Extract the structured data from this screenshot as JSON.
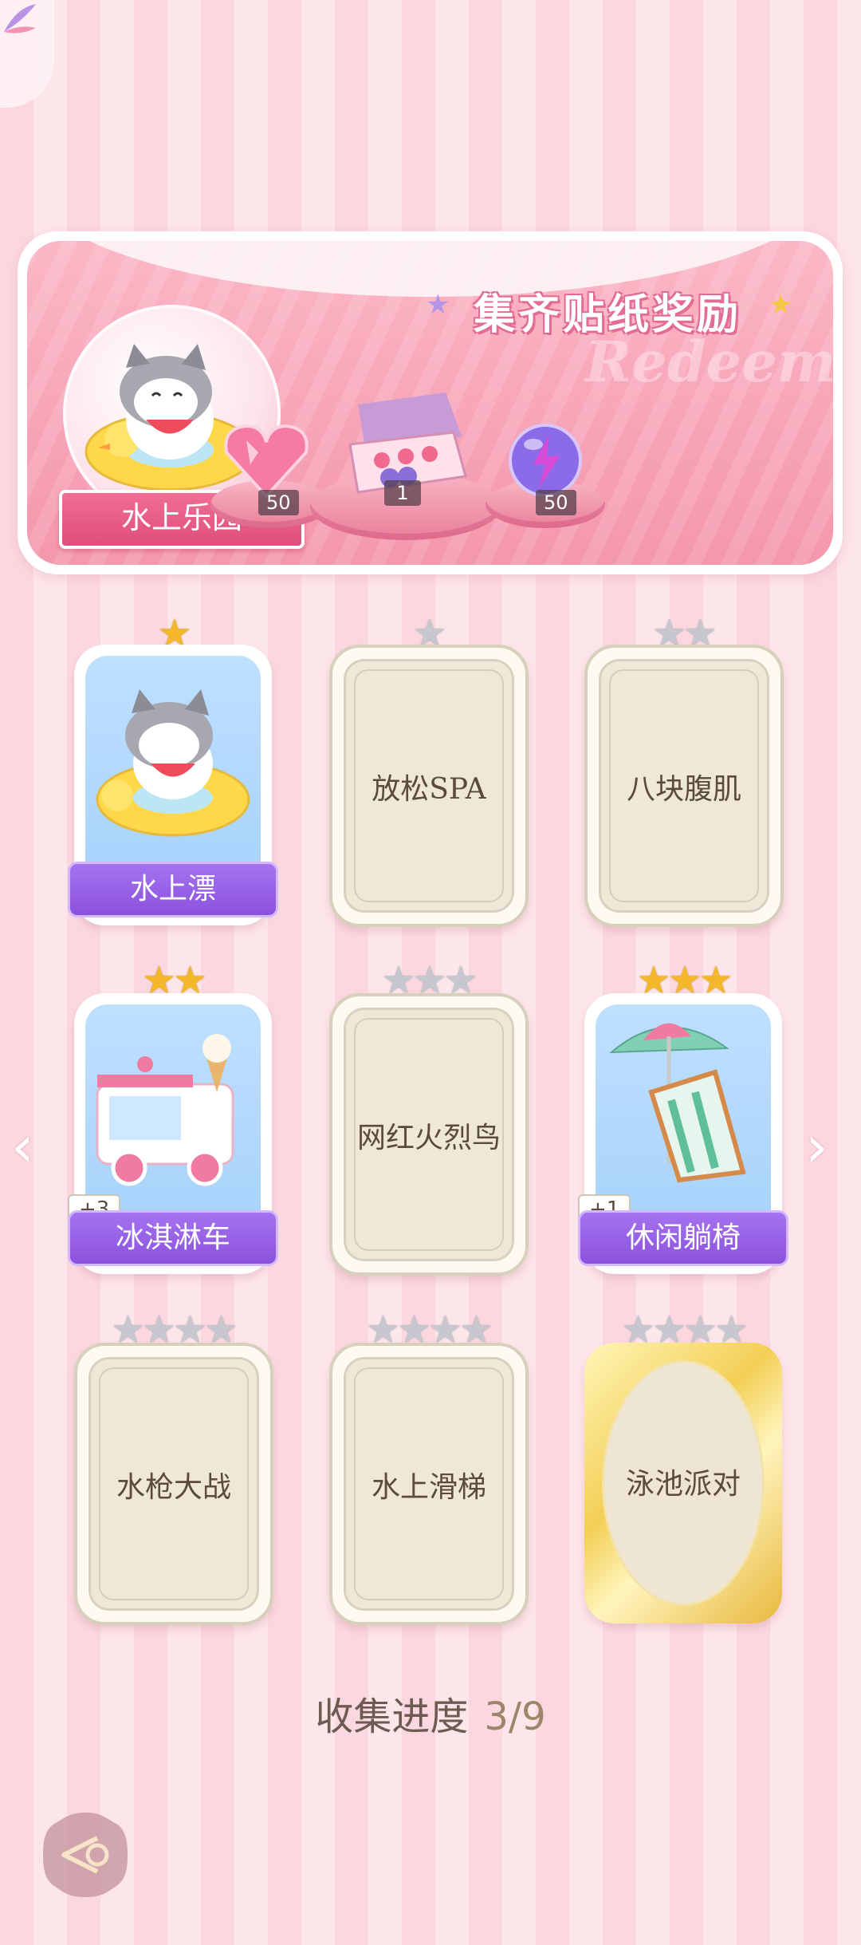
{
  "banner": {
    "title": "集齐贴纸奖励",
    "watermark": "Redeem",
    "theme_label": "水上乐园",
    "rewards": [
      {
        "icon": "pink-heart-gem-icon",
        "count": "50"
      },
      {
        "icon": "sticker-box-icon",
        "count": "1"
      },
      {
        "icon": "energy-orb-icon",
        "count": "50"
      }
    ]
  },
  "cards": [
    {
      "name": "水上漂",
      "stars_earned": 1,
      "stars_total": 1,
      "unlocked": true,
      "badge": ""
    },
    {
      "name": "放松SPA",
      "stars_earned": 0,
      "stars_total": 1,
      "unlocked": false,
      "badge": ""
    },
    {
      "name": "八块腹肌",
      "stars_earned": 0,
      "stars_total": 2,
      "unlocked": false,
      "badge": ""
    },
    {
      "name": "冰淇淋车",
      "stars_earned": 2,
      "stars_total": 2,
      "unlocked": true,
      "badge": "+3"
    },
    {
      "name": "网红火烈鸟",
      "stars_earned": 0,
      "stars_total": 3,
      "unlocked": false,
      "badge": ""
    },
    {
      "name": "休闲躺椅",
      "stars_earned": 3,
      "stars_total": 3,
      "unlocked": true,
      "badge": "+1"
    },
    {
      "name": "水枪大战",
      "stars_earned": 0,
      "stars_total": 4,
      "unlocked": false,
      "badge": ""
    },
    {
      "name": "水上滑梯",
      "stars_earned": 0,
      "stars_total": 4,
      "unlocked": false,
      "badge": ""
    },
    {
      "name": "泳池派对",
      "stars_earned": 0,
      "stars_total": 4,
      "unlocked": false,
      "badge": ""
    }
  ],
  "progress": {
    "label": "收集进度",
    "value": "3/9"
  },
  "nav": {
    "prev_icon": "chevron-left-icon",
    "next_icon": "chevron-right-icon",
    "back_icon": "back-arrow-icon"
  }
}
